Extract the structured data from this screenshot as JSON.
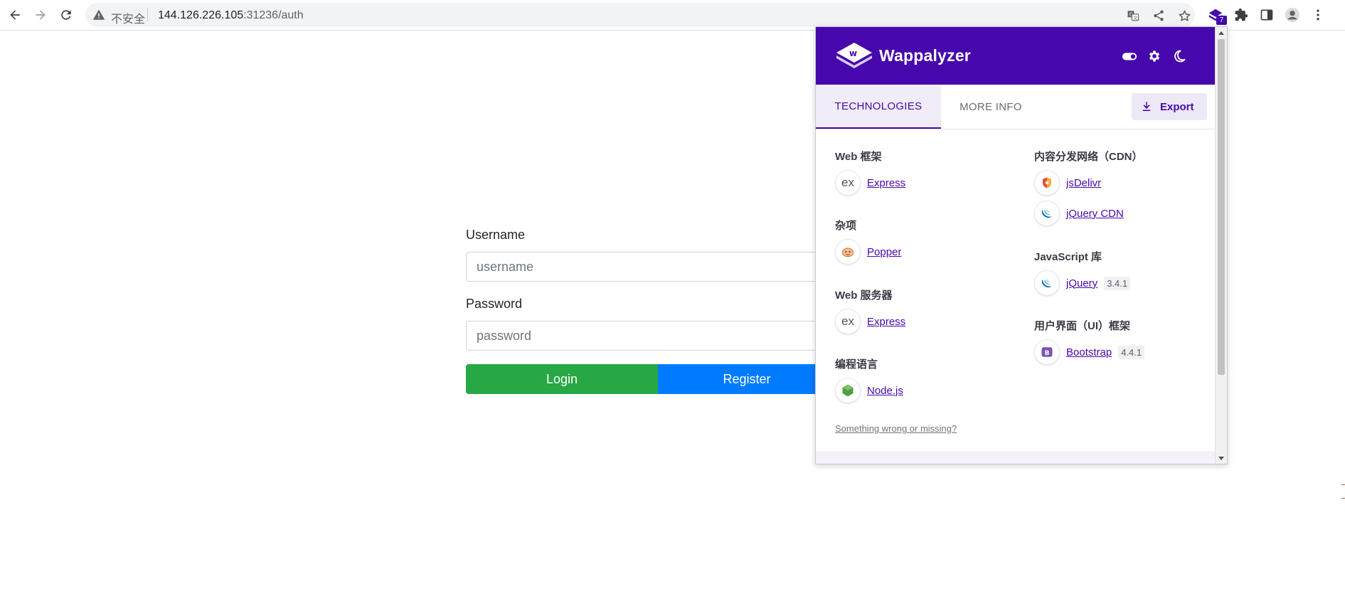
{
  "browser": {
    "security_label": "不安全",
    "url_host": "144.126.226.105",
    "url_rest": ":31236/auth",
    "extension_badge": "7",
    "icons": [
      "back-icon",
      "forward-icon",
      "reload-icon",
      "warning-icon",
      "translate-icon",
      "share-icon",
      "star-icon",
      "wappalyzer-extension-icon",
      "puzzle-icon",
      "side-panel-icon",
      "profile-icon",
      "kebab-menu-icon"
    ]
  },
  "login": {
    "username_label": "Username",
    "username_placeholder": "username",
    "password_label": "Password",
    "password_placeholder": "password",
    "login_button": "Login",
    "register_button": "Register",
    "colors": {
      "login": "#28a745",
      "register": "#007bff"
    }
  },
  "wappalyzer": {
    "title": "Wappalyzer",
    "brand_color": "#4608ad",
    "header_icons": [
      "toggle-icon",
      "settings-icon",
      "dark-mode-icon"
    ],
    "tabs": [
      "TECHNOLOGIES",
      "MORE INFO"
    ],
    "export_label": "Export",
    "feedback_link": "Something wrong or missing?",
    "left_column": [
      {
        "category": "Web 框架",
        "techs": [
          {
            "name": "Express",
            "version": "",
            "icon": "express-icon"
          }
        ]
      },
      {
        "category": "杂项",
        "techs": [
          {
            "name": "Popper",
            "version": "",
            "icon": "popper-icon"
          }
        ]
      },
      {
        "category": "Web 服务器",
        "techs": [
          {
            "name": "Express",
            "version": "",
            "icon": "express-icon"
          }
        ]
      },
      {
        "category": "编程语言",
        "techs": [
          {
            "name": "Node.js",
            "version": "",
            "icon": "nodejs-icon"
          }
        ]
      }
    ],
    "right_column": [
      {
        "category": "内容分发网络（CDN）",
        "techs": [
          {
            "name": "jsDelivr",
            "version": "",
            "icon": "jsdelivr-icon"
          },
          {
            "name": "jQuery CDN",
            "version": "",
            "icon": "jquery-icon"
          }
        ]
      },
      {
        "category": "JavaScript 库",
        "techs": [
          {
            "name": "jQuery",
            "version": "3.4.1",
            "icon": "jquery-icon"
          }
        ]
      },
      {
        "category": "用户界面（UI）框架",
        "techs": [
          {
            "name": "Bootstrap",
            "version": "4.4.1",
            "icon": "bootstrap-icon"
          }
        ]
      }
    ]
  }
}
